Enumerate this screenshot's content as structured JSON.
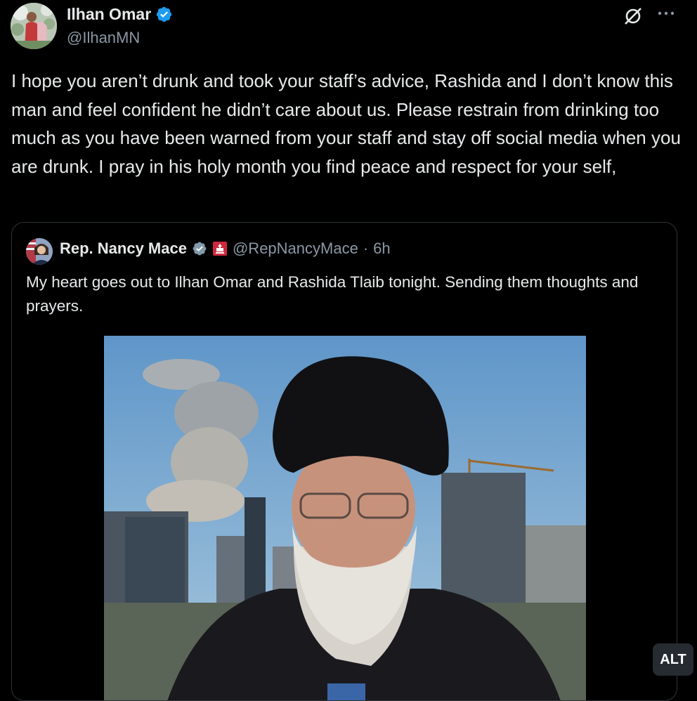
{
  "post": {
    "author_name": "Ilhan Omar",
    "author_handle": "@IlhanMN",
    "text": "I hope you aren’t drunk and took your staff’s advice, Rashida and I don’t know this man and feel confident he didn’t care about us. Please restrain from drinking too much as you have been warned from your staff and stay off social media when you are drunk. I pray in his holy month you find peace and respect for your self,",
    "verified_color": "#1d9bf0"
  },
  "quoted_post": {
    "author_name": "Rep. Nancy Mace",
    "author_handle": "@RepNancyMace",
    "separator": "·",
    "time": "6h",
    "text": "My heart goes out to Ilhan Omar and Rashida Tlaib tonight. Sending them thoughts and prayers.",
    "verified_color": "#829aab",
    "affiliation_color": "#d0283e"
  },
  "media": {
    "alt_label": "ALT"
  },
  "icons": {
    "verified": "verified-badge-icon",
    "grok": "grok-icon",
    "more": "more-icon",
    "affiliation": "affiliation-badge-icon"
  }
}
